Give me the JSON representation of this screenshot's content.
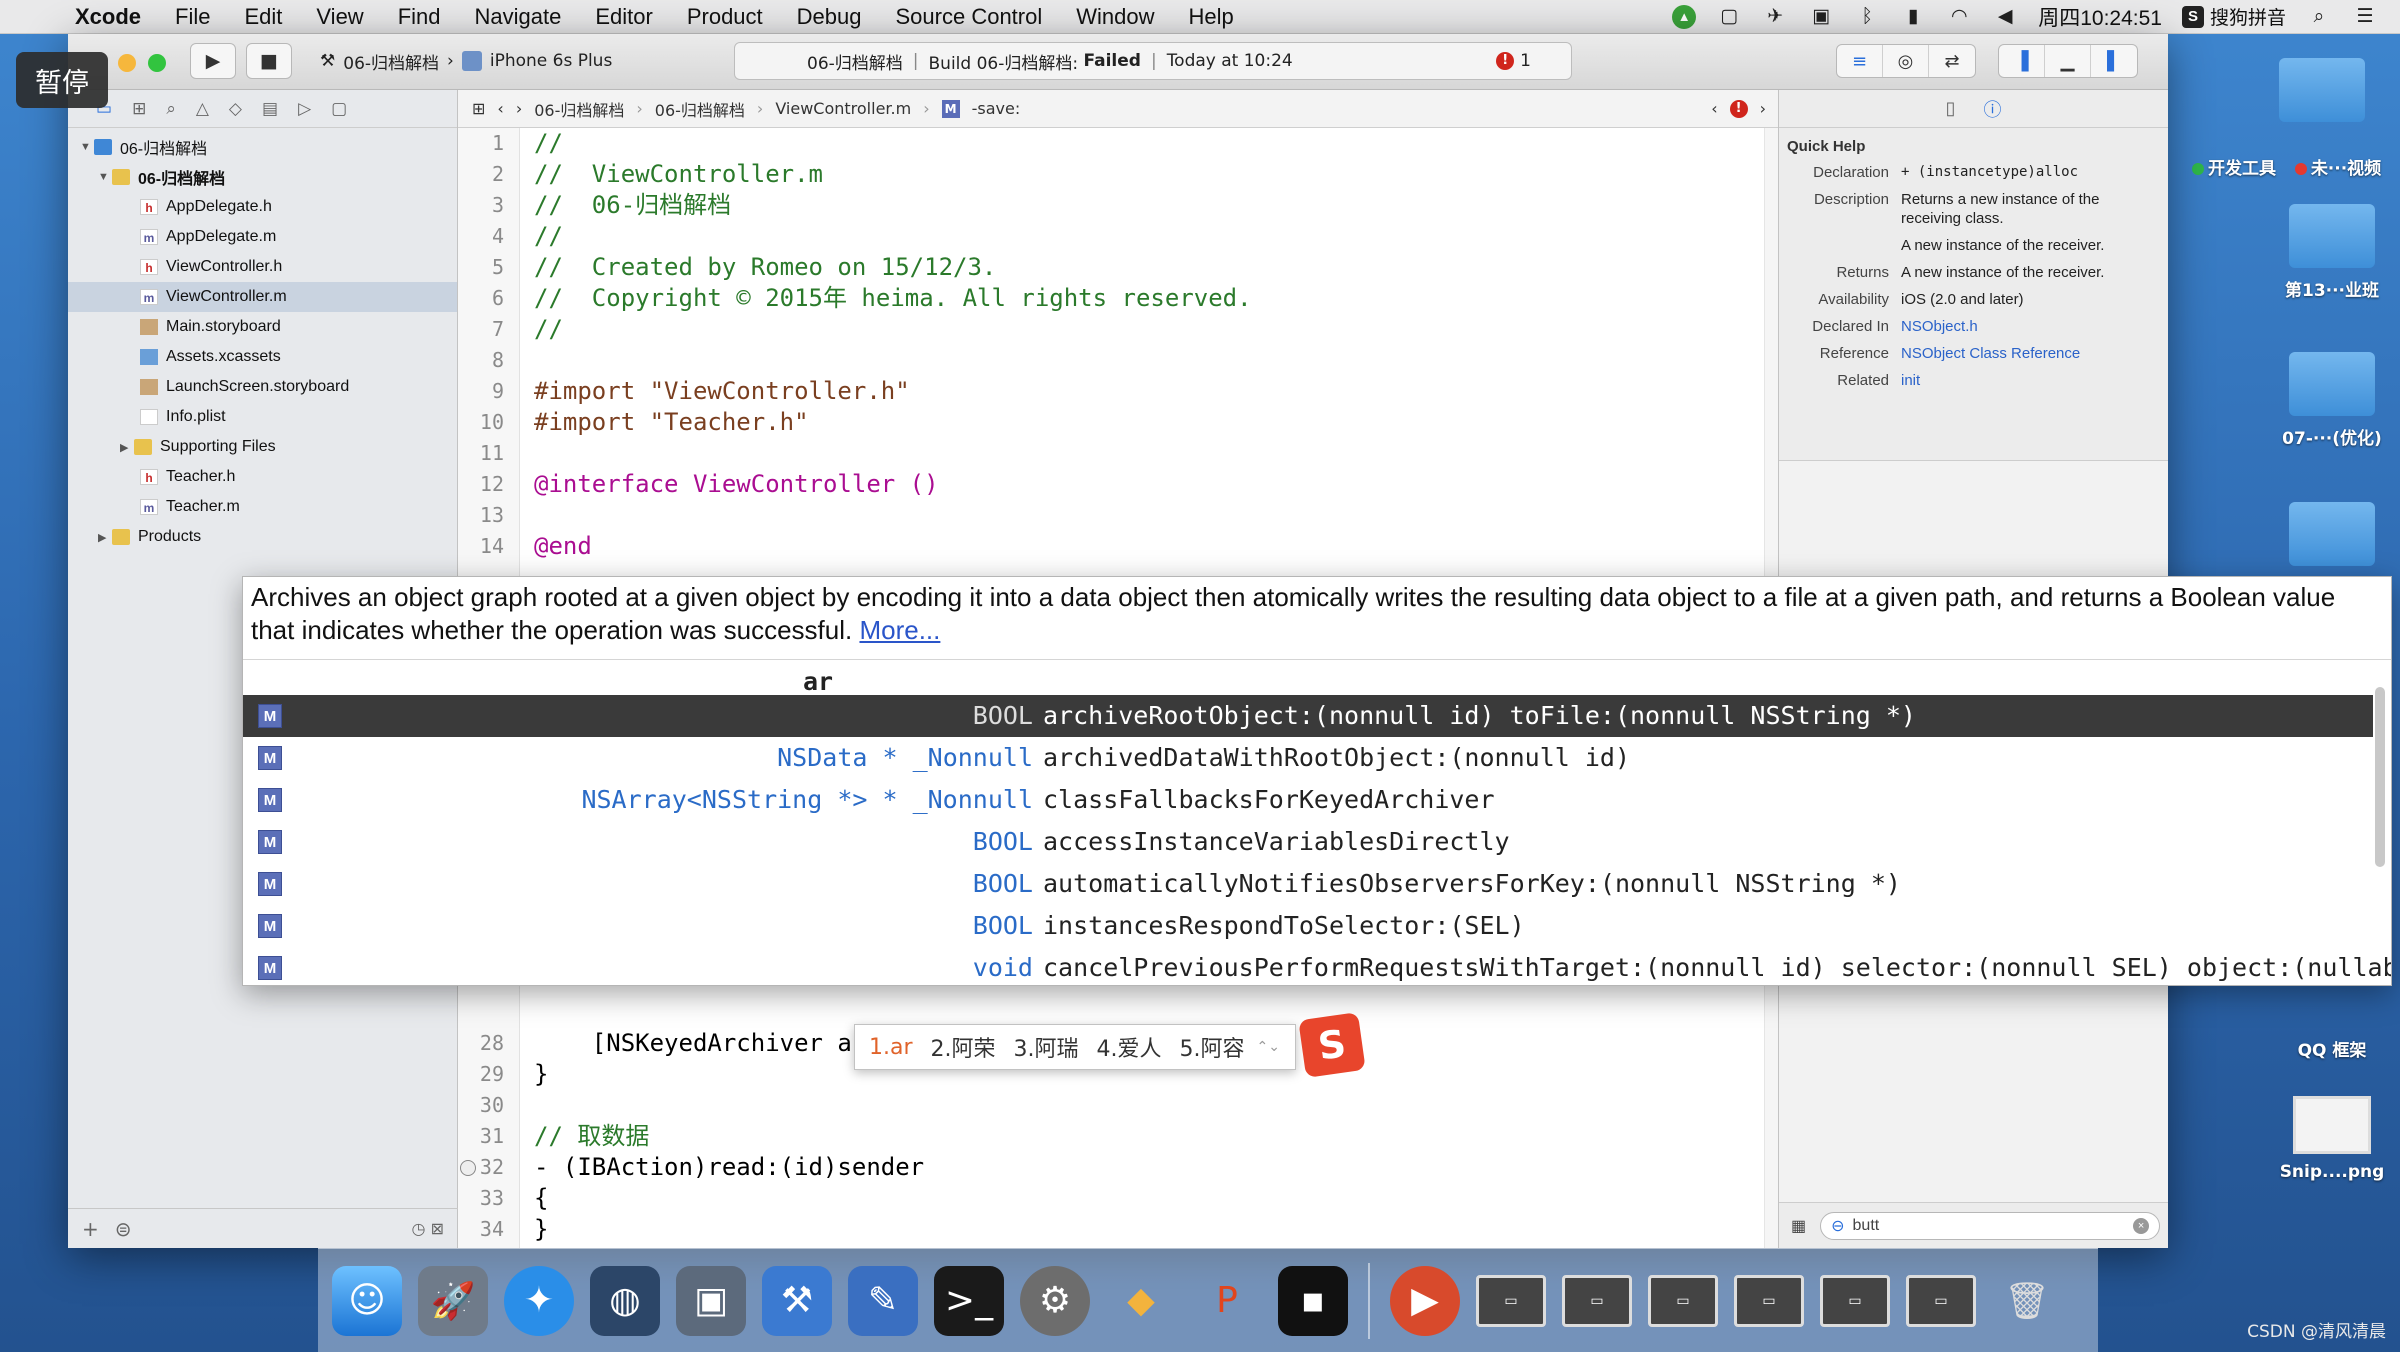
{
  "menubar": {
    "app": "Xcode",
    "items": [
      "File",
      "Edit",
      "View",
      "Find",
      "Navigate",
      "Editor",
      "Product",
      "Debug",
      "Source Control",
      "Window",
      "Help"
    ],
    "clock": "周四10:24:51",
    "ime": "搜狗拼音"
  },
  "overlay": {
    "paused": "暂停"
  },
  "toolbar": {
    "scheme": "06-归档解档",
    "device": "iPhone 6s Plus",
    "activity_project": "06-归档解档",
    "activity_build": "Build 06-归档解档:",
    "activity_status": "Failed",
    "activity_time": "Today at 10:24",
    "error_count": "1"
  },
  "navigator": {
    "project": "06-归档解档",
    "group": "06-归档解档",
    "files": [
      {
        "name": "AppDelegate.h",
        "type": "h"
      },
      {
        "name": "AppDelegate.m",
        "type": "m"
      },
      {
        "name": "ViewController.h",
        "type": "h"
      },
      {
        "name": "ViewController.m",
        "type": "m",
        "selected": true
      },
      {
        "name": "Main.storyboard",
        "type": "sb"
      },
      {
        "name": "Assets.xcassets",
        "type": "xc"
      },
      {
        "name": "LaunchScreen.storyboard",
        "type": "sb"
      },
      {
        "name": "Info.plist",
        "type": "pl"
      }
    ],
    "supporting": "Supporting Files",
    "teacher_h": "Teacher.h",
    "teacher_m": "Teacher.m",
    "products": "Products"
  },
  "jumpbar": {
    "project": "06-归档解档",
    "group": "06-归档解档",
    "file": "ViewController.m",
    "method": "-save:"
  },
  "editor": {
    "lines": [
      {
        "n": "1",
        "t": "//",
        "c": "cm"
      },
      {
        "n": "2",
        "t": "//  ViewController.m",
        "c": "cm"
      },
      {
        "n": "3",
        "t": "//  06-归档解档",
        "c": "cm"
      },
      {
        "n": "4",
        "t": "//",
        "c": "cm"
      },
      {
        "n": "5",
        "t": "//  Created by Romeo on 15/12/3.",
        "c": "cm"
      },
      {
        "n": "6",
        "t": "//  Copyright © 2015年 heima. All rights reserved.",
        "c": "cm"
      },
      {
        "n": "7",
        "t": "//",
        "c": "cm"
      },
      {
        "n": "8",
        "t": "",
        "c": ""
      },
      {
        "n": "9",
        "t": "#import \"ViewController.h\"",
        "c": "pp"
      },
      {
        "n": "10",
        "t": "#import \"Teacher.h\"",
        "c": "pp"
      },
      {
        "n": "11",
        "t": "",
        "c": ""
      },
      {
        "n": "12",
        "t": "@interface ViewController ()",
        "c": "kw"
      },
      {
        "n": "13",
        "t": "",
        "c": ""
      },
      {
        "n": "14",
        "t": "@end",
        "c": "kw"
      },
      {
        "n": "28",
        "t": "    [NSKeyedArchiver ar]",
        "c": ""
      },
      {
        "n": "29",
        "t": "}",
        "c": ""
      },
      {
        "n": "30",
        "t": "",
        "c": ""
      },
      {
        "n": "31",
        "t": "// 取数据",
        "c": "cm"
      },
      {
        "n": "32",
        "t": "- (IBAction)read:(id)sender",
        "c": ""
      },
      {
        "n": "33",
        "t": "{",
        "c": ""
      },
      {
        "n": "34",
        "t": "}",
        "c": ""
      },
      {
        "n": "35",
        "t": "",
        "c": ""
      }
    ]
  },
  "quickhelp": {
    "title": "Quick Help",
    "declaration_k": "Declaration",
    "declaration_v": "+ (instancetype)alloc",
    "description_k": "Description",
    "description_v": "Returns a new instance of the receiving class.",
    "description_v2": "A new instance of the receiver.",
    "returns_k": "Returns",
    "returns_v": "A new instance of the receiver.",
    "availability_k": "Availability",
    "availability_v": "iOS (2.0 and later)",
    "declared_k": "Declared In",
    "declared_v": "NSObject.h",
    "reference_k": "Reference",
    "reference_v": "NSObject Class Reference",
    "related_k": "Related",
    "related_v": "init",
    "filter": "butt"
  },
  "completion": {
    "doc": "Archives an object graph rooted at a given object by encoding it into a data object then atomically writes the resulting data object to a file at a given path, and returns a Boolean value that indicates whether the operation was successful.",
    "more": "More...",
    "prefix": "ar",
    "items": [
      {
        "kind": "M",
        "ret": "BOOL",
        "sig": "archiveRootObject:(nonnull id) toFile:(nonnull NSString *)",
        "selected": true
      },
      {
        "kind": "M",
        "ret": "NSData * _Nonnull",
        "sig": "archivedDataWithRootObject:(nonnull id)"
      },
      {
        "kind": "M",
        "ret": "NSArray<NSString *> * _Nonnull",
        "sig": "classFallbacksForKeyedArchiver"
      },
      {
        "kind": "M",
        "ret": "BOOL",
        "sig": "accessInstanceVariablesDirectly"
      },
      {
        "kind": "M",
        "ret": "BOOL",
        "sig": "automaticallyNotifiesObserversForKey:(nonnull NSString *)"
      },
      {
        "kind": "M",
        "ret": "BOOL",
        "sig": "instancesRespondToSelector:(SEL)"
      },
      {
        "kind": "M",
        "ret": "void",
        "sig": "cancelPreviousPerformRequestsWithTarget:(nonnull id) selector:(nonnull SEL) object:(nullable id)"
      }
    ]
  },
  "ime": {
    "candidates": [
      "1.ar",
      "2.阿荣",
      "3.阿瑞",
      "4.爱人",
      "5.阿容"
    ]
  },
  "desktop": {
    "icons": [
      "开发工具",
      "未···视频",
      "第13···业班",
      "07-···(优化)",
      "QQ 框架",
      "Snip....png"
    ]
  },
  "watermark": "CSDN @清风清晨"
}
